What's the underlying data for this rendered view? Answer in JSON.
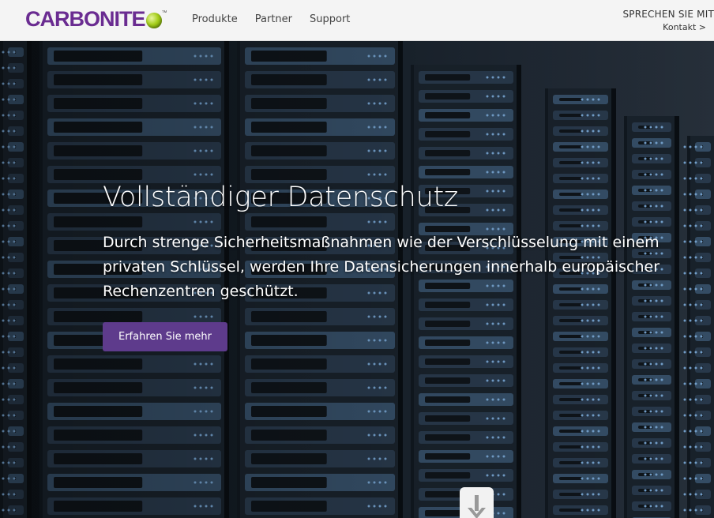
{
  "header": {
    "logo_text": "CARBONITE",
    "logo_tm": "™",
    "nav": [
      "Produkte",
      "Partner",
      "Support"
    ],
    "contact_line1": "SPRECHEN SIE MIT",
    "contact_line2": "Kontakt >"
  },
  "hero": {
    "title": "Vollständiger Datenschutz",
    "text": "Durch strenge Sicherheitsmaßnahmen wie der Verschlüsselung mit einem privaten Schlüssel, werden Ihre Datensicherungen innerhalb europäischer Rechenzentren geschützt.",
    "cta_label": "Erfahren Sie mehr",
    "scroll_icon": "arrow-down-icon"
  },
  "colors": {
    "brand_purple": "#6a2c91",
    "cta_purple": "#5e3b8c",
    "header_bg": "#f4f4f4"
  }
}
